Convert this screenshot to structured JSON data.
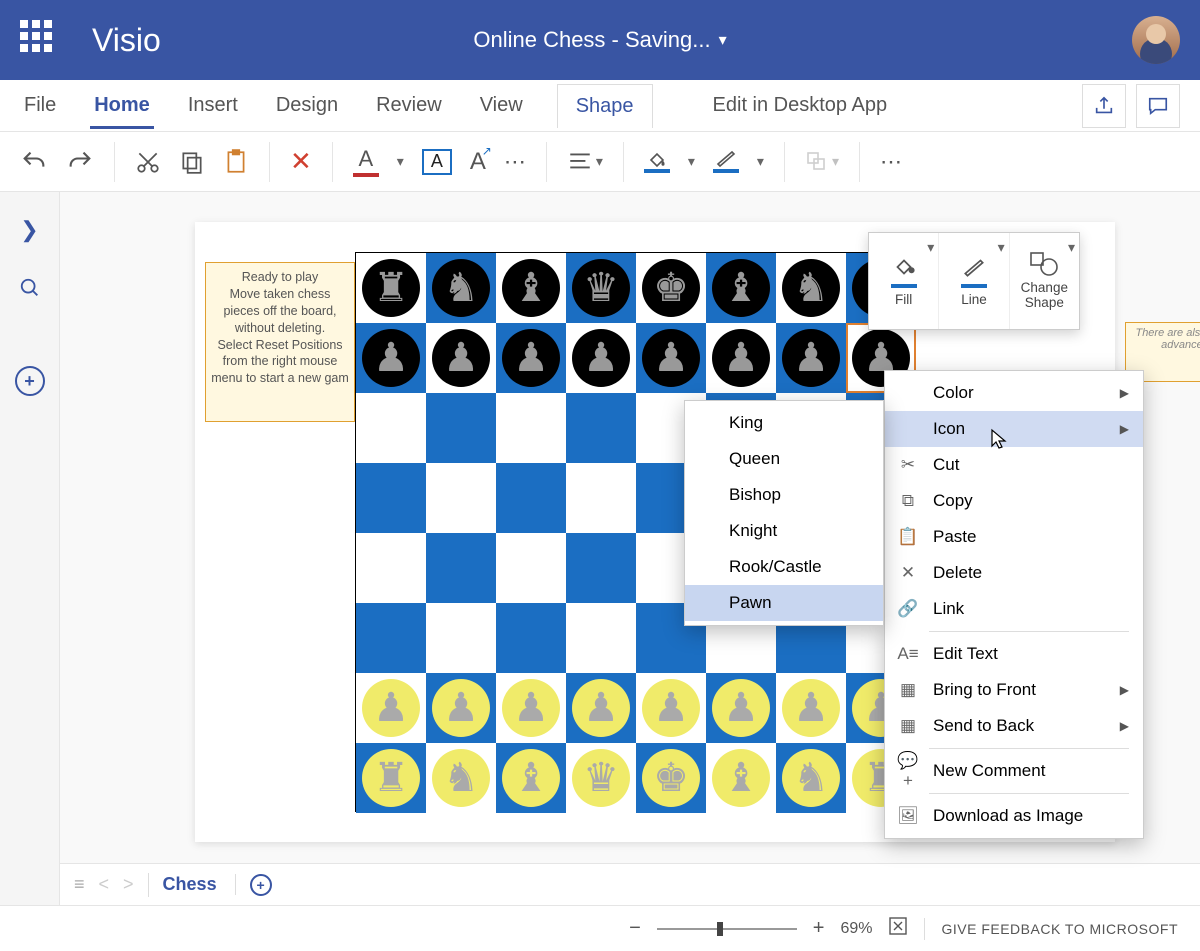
{
  "header": {
    "app_name": "Visio",
    "doc_title": "Online Chess  -  Saving..."
  },
  "tabs": [
    "File",
    "Home",
    "Insert",
    "Design",
    "Review",
    "View",
    "Shape"
  ],
  "tabs_active": "Shape",
  "tabs_underline": "Home",
  "desktop_link": "Edit in Desktop App",
  "ribbon": {
    "accent": "#3955a3",
    "fill_color": "#1b6ec2",
    "line_color": "#1b6ec2"
  },
  "note_text": "Ready to play\nMove taken chess pieces off the board, without deleting.\nSelect Reset Positions from the right mouse menu to start a new gam",
  "note2_text": "There are also more advanced",
  "board": {
    "dark_color": "#1b6ec2",
    "light_color": "#ffffff",
    "rows": [
      [
        {
          "side": "b",
          "p": "r"
        },
        {
          "side": "b",
          "p": "n"
        },
        {
          "side": "b",
          "p": "b"
        },
        {
          "side": "b",
          "p": "q"
        },
        {
          "side": "b",
          "p": "k"
        },
        {
          "side": "b",
          "p": "b"
        },
        {
          "side": "b",
          "p": "n"
        },
        {
          "side": "b",
          "p": "r"
        }
      ],
      [
        {
          "side": "b",
          "p": "p"
        },
        {
          "side": "b",
          "p": "p"
        },
        {
          "side": "b",
          "p": "p"
        },
        {
          "side": "b",
          "p": "p"
        },
        {
          "side": "b",
          "p": "p"
        },
        {
          "side": "b",
          "p": "p"
        },
        {
          "side": "b",
          "p": "p"
        },
        {
          "side": "b",
          "p": "p",
          "sel": true
        }
      ],
      [
        null,
        null,
        null,
        null,
        null,
        null,
        null,
        null
      ],
      [
        null,
        null,
        null,
        null,
        null,
        null,
        null,
        null
      ],
      [
        null,
        null,
        null,
        null,
        null,
        null,
        null,
        null
      ],
      [
        null,
        null,
        null,
        null,
        null,
        null,
        null,
        null
      ],
      [
        {
          "side": "w",
          "p": "p"
        },
        {
          "side": "w",
          "p": "p"
        },
        {
          "side": "w",
          "p": "p"
        },
        {
          "side": "w",
          "p": "p"
        },
        {
          "side": "w",
          "p": "p"
        },
        {
          "side": "w",
          "p": "p"
        },
        {
          "side": "w",
          "p": "p"
        },
        {
          "side": "w",
          "p": "p"
        }
      ],
      [
        {
          "side": "w",
          "p": "r"
        },
        {
          "side": "w",
          "p": "n"
        },
        {
          "side": "w",
          "p": "b"
        },
        {
          "side": "w",
          "p": "q"
        },
        {
          "side": "w",
          "p": "k"
        },
        {
          "side": "w",
          "p": "b"
        },
        {
          "side": "w",
          "p": "n"
        },
        {
          "side": "w",
          "p": "r"
        }
      ]
    ]
  },
  "mini_toolbar": [
    "Fill",
    "Line",
    "Change Shape"
  ],
  "context_menu": [
    {
      "label": "Color",
      "arrow": true
    },
    {
      "label": "Icon",
      "arrow": true,
      "highlight": true
    },
    {
      "label": "Cut",
      "icon": "cut"
    },
    {
      "label": "Copy",
      "icon": "copy"
    },
    {
      "label": "Paste",
      "icon": "paste"
    },
    {
      "label": "Delete",
      "icon": "delete"
    },
    {
      "label": "Link",
      "icon": "link"
    },
    {
      "label": "Edit Text",
      "icon": "edit",
      "divider_before": true
    },
    {
      "label": "Bring to Front",
      "icon": "front",
      "arrow": true
    },
    {
      "label": "Send to Back",
      "icon": "back",
      "arrow": true
    },
    {
      "label": "New Comment",
      "icon": "comment",
      "divider_before": true
    },
    {
      "label": "Download as Image",
      "icon": "download",
      "divider_before": true
    }
  ],
  "submenu": [
    "King",
    "Queen",
    "Bishop",
    "Knight",
    "Rook/Castle",
    "Pawn"
  ],
  "submenu_highlight": "Pawn",
  "page_name": "Chess",
  "status": {
    "zoom": "69%",
    "feedback": "GIVE FEEDBACK TO MICROSOFT"
  }
}
